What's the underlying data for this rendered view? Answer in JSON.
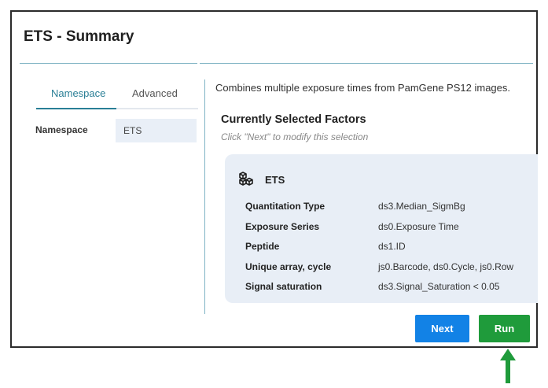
{
  "dialog": {
    "title": "ETS - Summary"
  },
  "left_panel": {
    "tabs": [
      {
        "label": "Namespace",
        "active": true
      },
      {
        "label": "Advanced",
        "active": false
      }
    ],
    "namespace_label": "Namespace",
    "namespace_value": "ETS"
  },
  "right_panel": {
    "description": "Combines multiple exposure times from PamGene PS12 images.",
    "section_title": "Currently Selected Factors",
    "hint": "Click \"Next\" to modify this selection",
    "factor_icon": "cubes-icon",
    "factor_name": "ETS",
    "factors": [
      {
        "label": "Quantitation Type",
        "value": "ds3.Median_SigmBg"
      },
      {
        "label": "Exposure Series",
        "value": "ds0.Exposure Time"
      },
      {
        "label": "Peptide",
        "value": "ds1.ID"
      },
      {
        "label": "Unique array, cycle",
        "value": "js0.Barcode, ds0.Cycle, js0.Row"
      },
      {
        "label": "Signal saturation",
        "value": "ds3.Signal_Saturation < 0.05"
      }
    ]
  },
  "buttons": {
    "next_label": "Next",
    "run_label": "Run"
  },
  "colors": {
    "accent": "#2a7f96",
    "next_button": "#1282e6",
    "run_button": "#1f9b3b",
    "annotation_arrow": "#1f9b3b"
  }
}
